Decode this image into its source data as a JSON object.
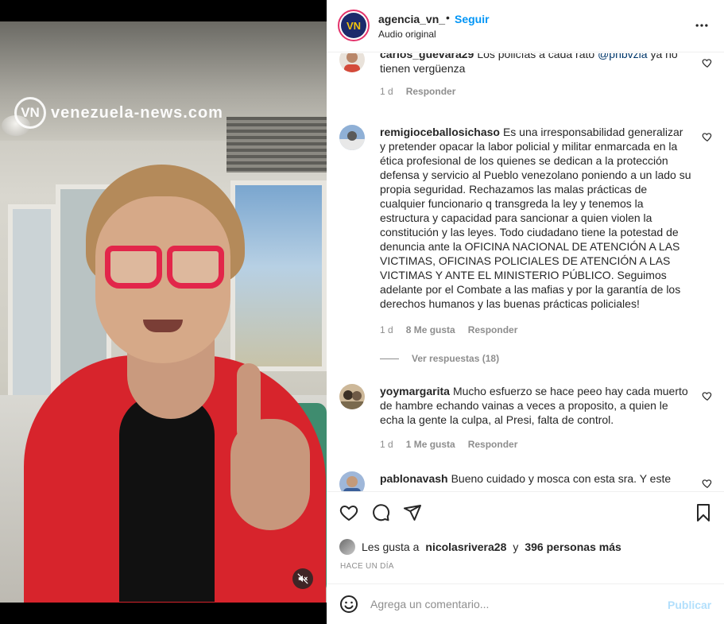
{
  "video": {
    "watermark_logo": "VN",
    "watermark_text": "venezuela-news.com"
  },
  "header": {
    "username": "agencia_vn_",
    "separator": "•",
    "follow_label": "Seguir",
    "audio_label": "Audio original",
    "avatar_initials": "VN"
  },
  "comments": [
    {
      "username": "carlos_guevara29",
      "text": "Los policías a cada rato",
      "mention": "@pnbvzla",
      "text_after": "ya no tienen vergüenza",
      "time": "1 d",
      "likes": "",
      "reply_label": "Responder",
      "avatar_color": "#d44a3a"
    },
    {
      "username": "remigioceballosichaso",
      "text": "Es una irresponsabilidad generalizar y pretender opacar la labor policial y militar enmarcada en la ética profesional de los quienes se dedican a la protección defensa y servicio al Pueblo venezolano poniendo a un lado su propia seguridad. Rechazamos las malas prácticas de cualquier funcionario q transgreda la ley y tenemos la estructura y capacidad para sancionar a quien violen la constitución y las leyes. Todo ciudadano tiene la potestad de denuncia ante la OFICINA NACIONAL DE ATENCIÓN A LAS VICTIMAS, OFICINAS POLICIALES DE ATENCIÓN A LAS VICTIMAS Y ANTE EL MINISTERIO PÚBLICO. Seguimos adelante por el Combate a las mafias y por la garantía de los derechos humanos y las buenas prácticas policiales!",
      "time": "1 d",
      "likes": "8 Me gusta",
      "reply_label": "Responder",
      "view_replies": "Ver respuestas (18)",
      "avatar_color": "#6d8fb8"
    },
    {
      "username": "yoymargarita",
      "text": "Mucho esfuerzo se hace peeo hay cada muerto de hambre echando vainas a veces a proposito, a quien le echa la gente la culpa, al Presi, falta de control.",
      "time": "1 d",
      "likes": "1 Me gusta",
      "reply_label": "Responder",
      "avatar_color": "#7a6a4e"
    },
    {
      "username": "pablonavash",
      "text": "Bueno cuidado y mosca con esta sra. Y este",
      "avatar_color": "#3b5f9a"
    }
  ],
  "actions": {
    "likes_prefix": "Les gusta a",
    "likes_user": "nicolasrivera28",
    "likes_connector": "y",
    "likes_others": "396 personas más",
    "time_ago": "HACE UN DÍA"
  },
  "composer": {
    "placeholder": "Agrega un comentario...",
    "publish_label": "Publicar"
  },
  "colors": {
    "accent": "#0095f6",
    "publish_disabled": "#b2dffc",
    "muted_text": "#8e8e8e"
  },
  "icons": [
    "more-icon",
    "heart-icon",
    "comment-icon",
    "share-icon",
    "bookmark-icon",
    "emoji-icon",
    "mute-icon"
  ]
}
